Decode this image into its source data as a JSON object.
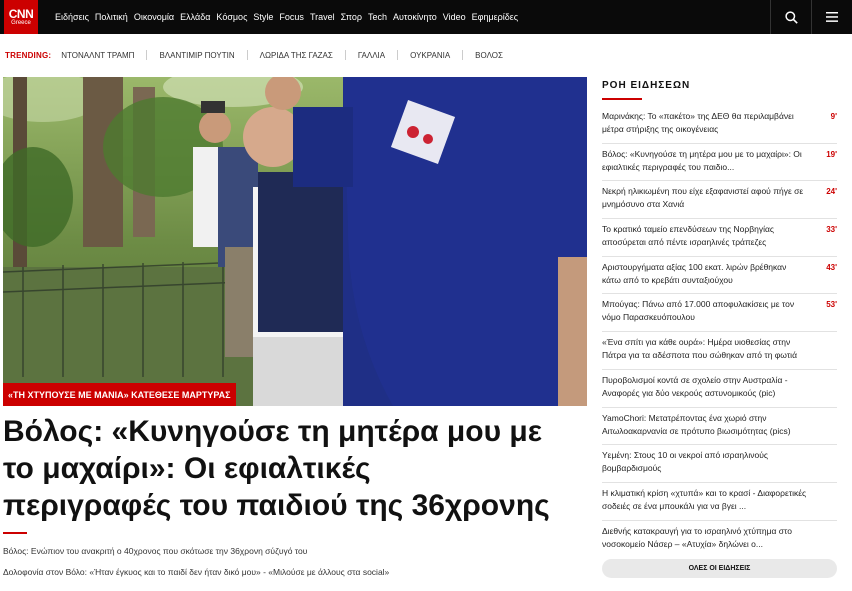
{
  "header": {
    "logo_main": "CNN",
    "logo_sub": "Greece",
    "nav": [
      "Ειδήσεις",
      "Πολιτική",
      "Οικονομία",
      "Ελλάδα",
      "Κόσμος",
      "Style",
      "Focus",
      "Travel",
      "Σπορ",
      "Tech",
      "Αυτοκίνητο",
      "Video",
      "Εφημερίδες"
    ],
    "icons": [
      "search-icon",
      "menu-icon"
    ]
  },
  "trending": {
    "label": "TRENDING:",
    "items": [
      "ΝΤΟΝΑΛΝΤ ΤΡΑΜΠ",
      "ΒΛΑΝΤΙΜΙΡ ΠΟΥΤΙΝ",
      "ΛΩΡΙΔΑ ΤΗΣ ΓΑΖΑΣ",
      "ΓΑΛΛΙΑ",
      "ΟΥΚΡΑΝΙΑ",
      "ΒΟΛΟΣ"
    ]
  },
  "main": {
    "tag": "«ΤΗ ΧΤΥΠΟΥΣΕ ΜΕ ΜΑΝΙΑ» ΚΑΤΕΘΕΣΕ ΜΑΡΤΥΡΑΣ",
    "headline_lines": [
      "Βόλος: «Κυνηγούσε τη μητέρα μου με",
      "το μαχαίρι»: Οι εφιαλτικές",
      "περιγραφές του παιδιού της 36χρονης"
    ],
    "related": [
      "Βόλος: Ενώπιον του ανακριτή ο 40χρονος που σκότωσε την 36χρονη σύζυγό του",
      "Δολοφονία στον Βόλο: «Ήταν έγκυος και το παιδί δεν ήταν δικό μου» - «Μιλούσε με άλλους στα social»"
    ]
  },
  "sidebar": {
    "title": "ΡΟΗ ΕΙΔΗΣΕΩΝ",
    "items": [
      {
        "text": "Μαρινάκης: Το «πακέτο» της ΔΕΘ θα περιλαμβάνει μέτρα στήριξης της οικογένειας",
        "ago": "9'"
      },
      {
        "text": "Βόλος: «Κυνηγούσε τη μητέρα μου με το μαχαίρι»: Οι εφιαλτικές περιγραφές του παιδιο...",
        "ago": "19'"
      },
      {
        "text": "Νεκρή ηλικιωμένη που είχε εξαφανιστεί αφού πήγε σε μνημόσυνο στα Χανιά",
        "ago": "24'"
      },
      {
        "text": "Το κρατικό ταμείο επενδύσεων της Νορβηγίας αποσύρεται από πέντε ισραηλινές τράπεζες",
        "ago": "33'"
      },
      {
        "text": "Αριστουργήματα αξίας 100 εκατ. λιρών βρέθηκαν κάτω από το κρεβάτι συνταξιούχου",
        "ago": "43'"
      },
      {
        "text": "Μπούγας: Πάνω από 17.000 αποφυλακίσεις με τον νόμο Παρασκευόπουλου",
        "ago": "53'"
      },
      {
        "text": "«Ένα σπίτι για κάθε ουρά»: Ημέρα υιοθεσίας στην Πάτρα για τα αδέσποτα που σώθηκαν από τη φωτιά",
        "ago": ""
      },
      {
        "text": "Πυροβολισμοί κοντά σε σχολείο στην Αυστραλία - Αναφορές για δύο νεκρούς αστυνομικούς (pic)",
        "ago": ""
      },
      {
        "text": "YamoChori: Μετατρέποντας ένα χωριό στην Αιτωλοακαρνανία σε πρότυπο βιωσιμότητας (pics)",
        "ago": ""
      },
      {
        "text": "Υεμένη: Στους 10 οι νεκροί από ισραηλινούς βομβαρδισμούς",
        "ago": ""
      },
      {
        "text": "Η κλιματική κρίση «χτυπά» και το κρασί - Διαφορετικές σοδειές σε ένα μπουκάλι για να βγει ...",
        "ago": ""
      },
      {
        "text": "Διεθνής κατακραυγή για το ισραηλινό χτύπημα στο νοσοκομείο Νάσερ – «Ατυχία» δηλώνει ο...",
        "ago": ""
      }
    ],
    "all_label": "ΟΛΕΣ ΟΙ ΕΙΔΗΣΕΙΣ"
  }
}
